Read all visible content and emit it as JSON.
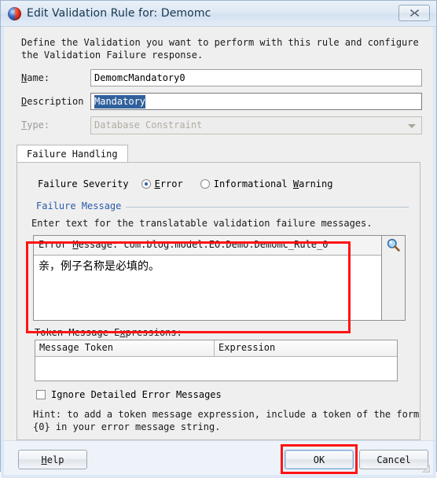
{
  "window": {
    "title": "Edit Validation Rule for: Demomc",
    "app_icon": "jdeveloper-sphere-icon",
    "close_label": "✖"
  },
  "intro": {
    "text": "Define the Validation you want to perform with this rule and configure the Validation Failure response."
  },
  "form": {
    "name_label": "Name:",
    "name_value": "DemomcMandatory0",
    "description_label": "Description",
    "description_value": "Mandatory",
    "type_label": "Type:",
    "type_value": "Database Constraint"
  },
  "tabs": [
    {
      "label": "Failure Handling",
      "selected": true
    }
  ],
  "severity": {
    "label": "Failure Severity",
    "options": [
      {
        "label": "Error",
        "checked": true
      },
      {
        "label": "Informational Warning",
        "checked": false
      }
    ]
  },
  "failure_message": {
    "group_title": "Failure Message",
    "hint": "Enter text for the translatable validation failure messages.",
    "header": "Error Message: com.blog.model.EO.Demo.Demomc_Rule_0",
    "header_label": "Error Message:",
    "header_value": "com.blog.model.EO.Demo.Demomc_Rule_0",
    "body_text": "亲，例子名称是必填的。",
    "search_icon": "magnifier-icon"
  },
  "tokens": {
    "label": "Token Message Expressions:",
    "columns": [
      "Message Token",
      "Expression"
    ],
    "rows": []
  },
  "ignore_checkbox": {
    "label": "Ignore Detailed Error Messages",
    "checked": false
  },
  "bottom_hint": {
    "text": "Hint: to add a token message expression, include a token of the form {0} in your error message string."
  },
  "footer": {
    "help_label": "Help",
    "ok_label": "OK",
    "cancel_label": "Cancel"
  },
  "annotations": {
    "accent_color": "#ff1414",
    "highlight_color": "#30619c",
    "link_color": "#2a5caa",
    "boxes": [
      "failure-message-area",
      "ok-button"
    ]
  }
}
